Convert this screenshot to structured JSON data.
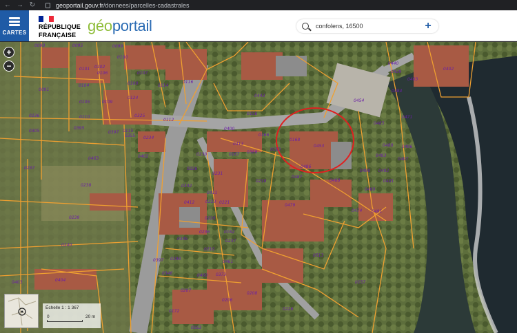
{
  "browser": {
    "back_icon": "back-arrow-icon",
    "forward_icon": "forward-arrow-icon",
    "reload_icon": "reload-icon",
    "url_host": "geoportail.gouv.fr",
    "url_path": "/donnees/parcelles-cadastrales"
  },
  "header": {
    "menu_label": "CARTES",
    "rf_line1": "RÉPUBLIQUE",
    "rf_line2": "FRANÇAISE",
    "logo_part1": "géo",
    "logo_part2": "portail",
    "flag_colors": [
      "#002395",
      "#ffffff",
      "#ed2939"
    ],
    "brand_color": "#1f5ba6"
  },
  "search": {
    "value": "confolens, 16500",
    "plus_label": "+"
  },
  "map": {
    "zoom_in": "+",
    "zoom_out": "−",
    "scale_label": "Échelle 1 : 1 367",
    "scale_min": "0",
    "scale_max": "20 m",
    "parcel_color": "#f0a030",
    "label_color": "#6a1fa6",
    "highlight_color": "#e02020",
    "parcels": [
      "0090",
      "0095",
      "0099",
      "0100",
      "0101",
      "0102",
      "0106",
      "0107",
      "0108",
      "0114",
      "0116",
      "0104",
      "0105",
      "0091",
      "0124",
      "0109",
      "0325",
      "0110",
      "0112",
      "0115",
      "0395",
      "0397",
      "0236",
      "0305",
      "0355",
      "0234",
      "0463",
      "0462",
      "0237",
      "0238",
      "0239",
      "0240",
      "0403",
      "0404",
      "0400",
      "0413",
      "0167",
      "0166",
      "0389",
      "0163",
      "0168",
      "0453",
      "0486",
      "0487",
      "0468",
      "0454",
      "0485",
      "0471",
      "0484",
      "0439",
      "0440",
      "0402",
      "0403",
      "0488",
      "0496",
      "0493",
      "0497",
      "0490",
      "0492",
      "0481",
      "0460",
      "0491",
      "0474",
      "0479",
      "0513",
      "0157",
      "0156",
      "0443",
      "0230",
      "0226",
      "0231",
      "0342",
      "0412",
      "0411",
      "0223",
      "0221",
      "0220",
      "0162",
      "0218",
      "0237",
      "0236",
      "0345",
      "0210",
      "0397",
      "0398",
      "0346",
      "0461",
      "0460",
      "0373",
      "0208",
      "0207",
      "0172",
      "0226",
      "0206",
      "0163"
    ]
  }
}
